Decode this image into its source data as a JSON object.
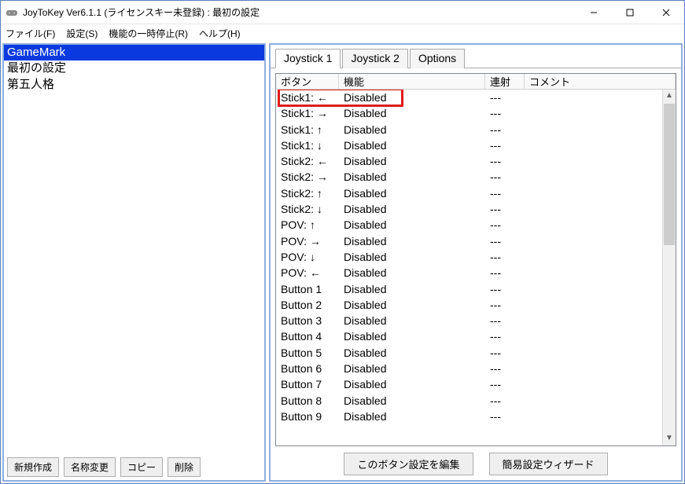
{
  "window": {
    "title": "JoyToKey Ver6.1.1 (ライセンスキー未登録) : 最初の設定"
  },
  "menu": {
    "file": "ファイル(F)",
    "settings": "設定(S)",
    "pause": "機能の一時停止(R)",
    "help": "ヘルプ(H)"
  },
  "profiles": {
    "items": [
      {
        "label": "GameMark",
        "selected": true
      },
      {
        "label": "最初の設定",
        "selected": false
      },
      {
        "label": "第五人格",
        "selected": false
      }
    ]
  },
  "leftbuttons": {
    "new": "新規作成",
    "rename": "名称変更",
    "copy": "コピー",
    "delete": "削除"
  },
  "tabs": {
    "items": [
      {
        "label": "Joystick 1",
        "active": true
      },
      {
        "label": "Joystick 2",
        "active": false
      },
      {
        "label": "Options",
        "active": false
      }
    ]
  },
  "table": {
    "headers": {
      "button": "ボタン",
      "function": "機能",
      "rapid": "連射",
      "comment": "コメント"
    },
    "rows": [
      {
        "btn": "Stick1: ←",
        "fn": "Disabled",
        "rapid": "---",
        "comment": ""
      },
      {
        "btn": "Stick1: →",
        "fn": "Disabled",
        "rapid": "---",
        "comment": ""
      },
      {
        "btn": "Stick1: ↑",
        "fn": "Disabled",
        "rapid": "---",
        "comment": ""
      },
      {
        "btn": "Stick1: ↓",
        "fn": "Disabled",
        "rapid": "---",
        "comment": ""
      },
      {
        "btn": "Stick2: ←",
        "fn": "Disabled",
        "rapid": "---",
        "comment": ""
      },
      {
        "btn": "Stick2: →",
        "fn": "Disabled",
        "rapid": "---",
        "comment": ""
      },
      {
        "btn": "Stick2: ↑",
        "fn": "Disabled",
        "rapid": "---",
        "comment": ""
      },
      {
        "btn": "Stick2: ↓",
        "fn": "Disabled",
        "rapid": "---",
        "comment": ""
      },
      {
        "btn": "POV: ↑",
        "fn": "Disabled",
        "rapid": "---",
        "comment": ""
      },
      {
        "btn": "POV: →",
        "fn": "Disabled",
        "rapid": "---",
        "comment": ""
      },
      {
        "btn": "POV: ↓",
        "fn": "Disabled",
        "rapid": "---",
        "comment": ""
      },
      {
        "btn": "POV: ←",
        "fn": "Disabled",
        "rapid": "---",
        "comment": ""
      },
      {
        "btn": "Button 1",
        "fn": "Disabled",
        "rapid": "---",
        "comment": ""
      },
      {
        "btn": "Button 2",
        "fn": "Disabled",
        "rapid": "---",
        "comment": ""
      },
      {
        "btn": "Button 3",
        "fn": "Disabled",
        "rapid": "---",
        "comment": ""
      },
      {
        "btn": "Button 4",
        "fn": "Disabled",
        "rapid": "---",
        "comment": ""
      },
      {
        "btn": "Button 5",
        "fn": "Disabled",
        "rapid": "---",
        "comment": ""
      },
      {
        "btn": "Button 6",
        "fn": "Disabled",
        "rapid": "---",
        "comment": ""
      },
      {
        "btn": "Button 7",
        "fn": "Disabled",
        "rapid": "---",
        "comment": ""
      },
      {
        "btn": "Button 8",
        "fn": "Disabled",
        "rapid": "---",
        "comment": ""
      },
      {
        "btn": "Button 9",
        "fn": "Disabled",
        "rapid": "---",
        "comment": ""
      }
    ]
  },
  "rightbuttons": {
    "edit": "このボタン設定を編集",
    "wizard": "簡易設定ウィザード"
  }
}
